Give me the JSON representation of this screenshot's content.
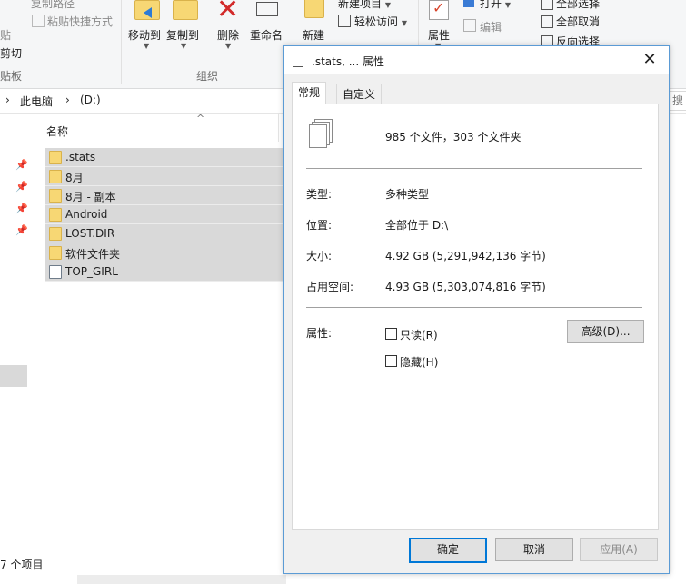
{
  "ribbon": {
    "clipboard": {
      "copy_path": "复制路径",
      "paste_shortcut": "粘贴快捷方式",
      "paste": "贴",
      "cut": "剪切",
      "group_label": "贴板"
    },
    "organize": {
      "move_to": "移动到",
      "copy_to": "复制到",
      "delete": "删除",
      "rename": "重命名",
      "group_label": "组织"
    },
    "new": {
      "new_folder": "新建",
      "new_item": "新建项目",
      "easy_access": "轻松访问"
    },
    "open": {
      "properties": "属性",
      "open": "打开",
      "edit": "编辑"
    },
    "select": {
      "select_all": "全部选择",
      "select_none": "全部取消",
      "invert": "反向选择"
    }
  },
  "address": {
    "crumbs": [
      "此电脑",
      "(D:)"
    ],
    "search_placeholder": "搜"
  },
  "file_list": {
    "column_name": "名称",
    "items": [
      {
        "name": ".stats",
        "type": "folder"
      },
      {
        "name": "8月",
        "type": "folder"
      },
      {
        "name": "8月 - 副本",
        "type": "folder"
      },
      {
        "name": "Android",
        "type": "folder"
      },
      {
        "name": "LOST.DIR",
        "type": "folder"
      },
      {
        "name": "软件文件夹",
        "type": "folder"
      },
      {
        "name": "TOP_GIRL",
        "type": "file"
      }
    ]
  },
  "status_bar": {
    "item_count": "7 个项目"
  },
  "dialog": {
    "title": ".stats, ... 属性",
    "tabs": [
      "常规",
      "自定义"
    ],
    "summary": "985 个文件，303 个文件夹",
    "rows": [
      {
        "label": "类型:",
        "value": "多种类型"
      },
      {
        "label": "位置:",
        "value": "全部位于 D:\\"
      },
      {
        "label": "大小:",
        "value": "4.92 GB (5,291,942,136 字节)"
      },
      {
        "label": "占用空间:",
        "value": "4.93 GB (5,303,074,816 字节)"
      }
    ],
    "attributes_label": "属性:",
    "readonly_label": "只读(R)",
    "hidden_label": "隐藏(H)",
    "advanced_button": "高级(D)...",
    "ok_button": "确定",
    "cancel_button": "取消",
    "apply_button": "应用(A)"
  }
}
